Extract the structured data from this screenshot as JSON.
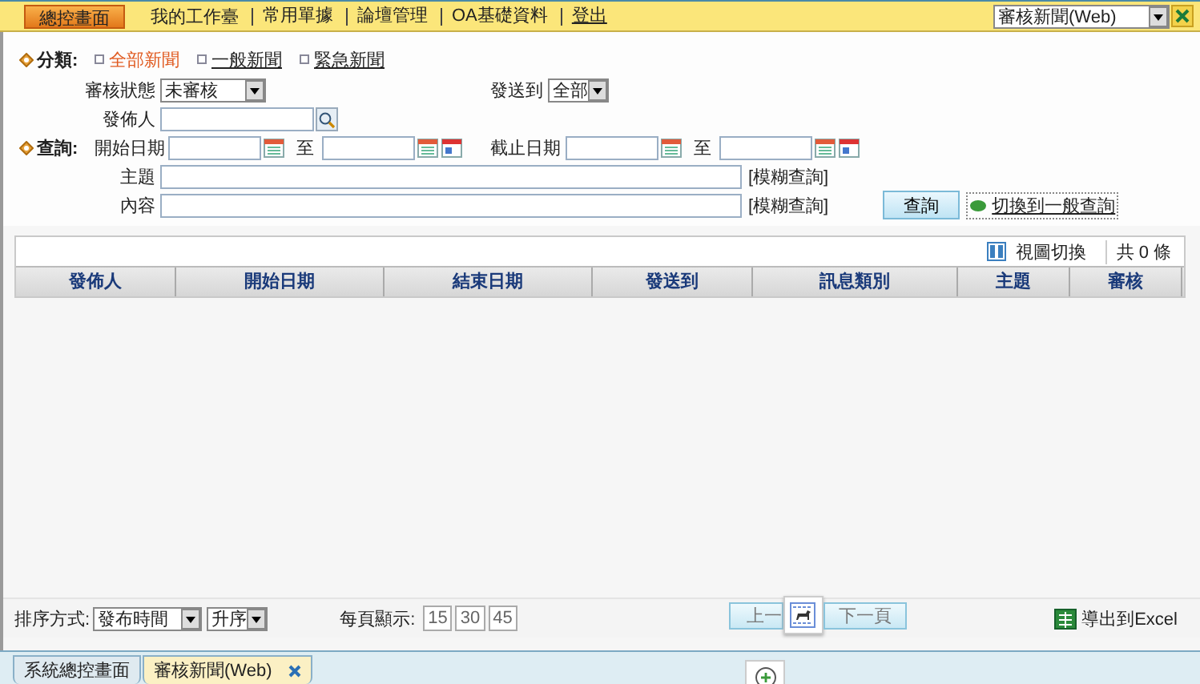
{
  "nav": {
    "home": "總控畫面",
    "links": [
      "我的工作臺",
      "常用單據",
      "論壇管理",
      "OA基礎資料"
    ],
    "logout": "登出",
    "window_select": "審核新聞(Web)"
  },
  "category": {
    "label": "分類:",
    "options": [
      {
        "label": "全部新聞",
        "selected": true
      },
      {
        "label": "一般新聞",
        "selected": false
      },
      {
        "label": "緊急新聞",
        "selected": false
      }
    ]
  },
  "review_status": {
    "label": "審核狀態",
    "value": "未審核"
  },
  "send_to": {
    "label": "發送到",
    "value": "全部"
  },
  "publisher": {
    "label": "發佈人"
  },
  "query_label": "查詢:",
  "start_date": {
    "label": "開始日期",
    "to": "至"
  },
  "end_date": {
    "label": "截止日期",
    "to": "至"
  },
  "subject": {
    "label": "主題",
    "hint": "[模糊查詢]"
  },
  "content": {
    "label": "內容",
    "hint": "[模糊查詢]"
  },
  "search_button": "查詢",
  "switch_link": "切換到一般查詢",
  "table": {
    "view_toggle": "視圖切換",
    "count": "共 0 條",
    "columns": [
      "發佈人",
      "開始日期",
      "結束日期",
      "發送到",
      "訊息類別",
      "主題",
      "審核"
    ]
  },
  "footer": {
    "sort_label": "排序方式:",
    "sort_field": "發布時間",
    "sort_order": "升序",
    "per_page_label": "每頁顯示:",
    "page_sizes": [
      "15",
      "30",
      "45"
    ],
    "prev": "上一",
    "next": "下一頁",
    "export": "導出到Excel"
  },
  "tabs": [
    {
      "label": "系統總控畫面",
      "selected": false,
      "closable": false
    },
    {
      "label": "審核新聞(Web)",
      "selected": true,
      "closable": true
    }
  ]
}
